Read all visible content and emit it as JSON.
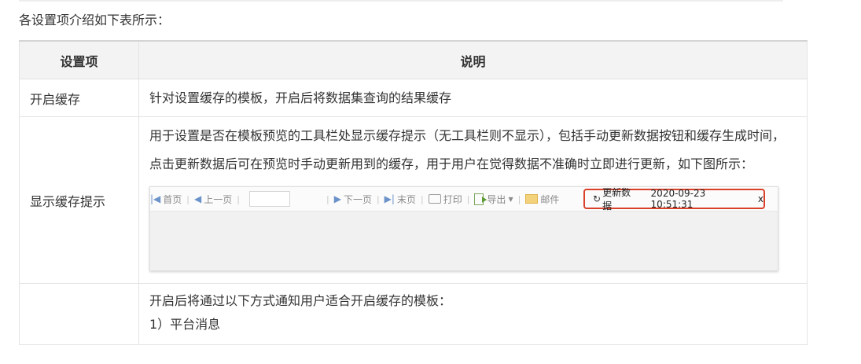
{
  "intro": "各设置项介绍如下表所示：",
  "table": {
    "headers": [
      "设置项",
      "说明"
    ],
    "rows": [
      {
        "name": "开启缓存",
        "desc": "针对设置缓存的模板，开启后将数据集查询的结果缓存"
      },
      {
        "name": "显示缓存提示",
        "desc": "用于设置是否在模板预览的工具栏处显示缓存提示（无工具栏则不显示），包括手动更新数据按钮和缓存生成时间，点击更新数据后可在预览时手动更新用到的缓存，用于用户在觉得数据不准确时立即进行更新，如下图所示："
      },
      {
        "name": "",
        "desc_line1": "开启后将通过以下方式通知用户适合开启缓存的模板：",
        "desc_line2": "1）平台消息"
      }
    ]
  },
  "toolbar": {
    "first": "首页",
    "prev": "上一页",
    "next": "下一页",
    "last": "末页",
    "print": "打印",
    "export": "导出",
    "mail": "邮件",
    "refresh": "更新数据",
    "cache_time": "2020-09-23 10:51:31",
    "close": "x",
    "highlight_color": "#d9412b"
  }
}
